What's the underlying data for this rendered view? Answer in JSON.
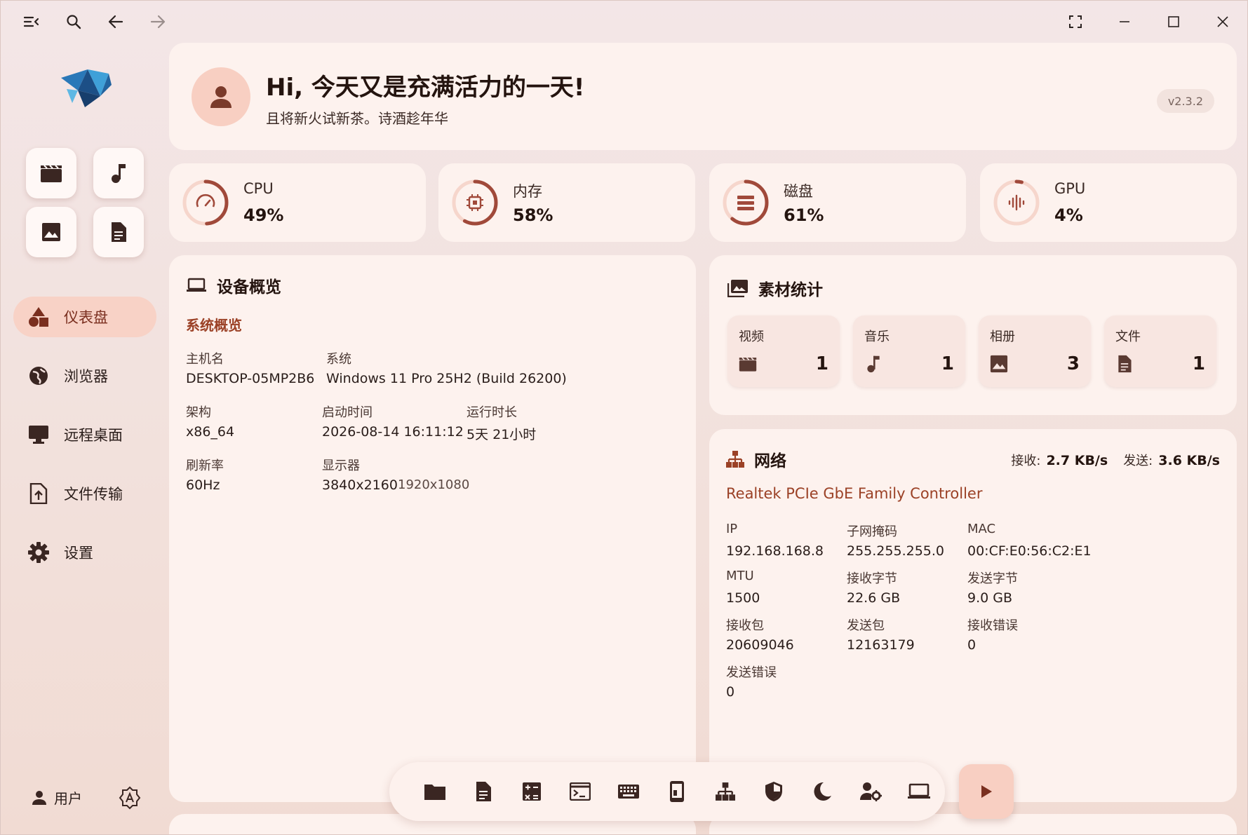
{
  "titlebar": {
    "left_icons": [
      "menu-collapse-icon",
      "search-icon",
      "back-arrow-icon",
      "forward-arrow-icon"
    ],
    "right_icons": [
      "fullscreen-icon",
      "minimize-icon",
      "maximize-icon",
      "close-icon"
    ]
  },
  "sidebar": {
    "quick_buttons": [
      "video-icon",
      "music-icon",
      "image-icon",
      "document-icon"
    ],
    "nav": [
      {
        "label": "仪表盘",
        "icon": "dashboard-shapes-icon",
        "active": true
      },
      {
        "label": "浏览器",
        "icon": "globe-icon",
        "active": false
      },
      {
        "label": "远程桌面",
        "icon": "monitor-icon",
        "active": false
      },
      {
        "label": "文件传输",
        "icon": "file-upload-icon",
        "active": false
      },
      {
        "label": "设置",
        "icon": "gear-icon",
        "active": false
      }
    ],
    "user_label": "用户"
  },
  "header": {
    "greeting": "Hi, 今天又是充满活力的一天!",
    "subtitle": "且将新火试新茶。诗酒趁年华",
    "version": "v2.3.2"
  },
  "stats": [
    {
      "label": "CPU",
      "value": "49%",
      "percent": 49,
      "icon": "speedometer-icon"
    },
    {
      "label": "内存",
      "value": "58%",
      "percent": 58,
      "icon": "chip-icon"
    },
    {
      "label": "磁盘",
      "value": "61%",
      "percent": 61,
      "icon": "disk-list-icon"
    },
    {
      "label": "GPU",
      "value": "4%",
      "percent": 4,
      "icon": "waveform-icon"
    }
  ],
  "device": {
    "title": "设备概览",
    "section": "系统概览",
    "hostname_label": "主机名",
    "hostname": "DESKTOP-05MP2B6",
    "os_label": "系统",
    "os": "Windows 11 Pro 25H2 (Build 26200)",
    "arch_label": "架构",
    "arch": "x86_64",
    "boot_label": "启动时间",
    "boot": "2026-08-14 16:11:12",
    "uptime_label": "运行时长",
    "uptime": "5天 21小时",
    "refresh_label": "刷新率",
    "refresh": "60Hz",
    "display_label": "显示器",
    "display_primary": "3840x2160",
    "display_secondary": "1920x1080"
  },
  "materials": {
    "title": "素材统计",
    "items": [
      {
        "label": "视频",
        "count": "1",
        "icon": "video-icon"
      },
      {
        "label": "音乐",
        "count": "1",
        "icon": "music-icon"
      },
      {
        "label": "相册",
        "count": "3",
        "icon": "image-icon"
      },
      {
        "label": "文件",
        "count": "1",
        "icon": "document-icon"
      }
    ]
  },
  "network": {
    "title": "网络",
    "recv_label": "接收:",
    "recv_rate": "2.7 KB/s",
    "send_label": "发送:",
    "send_rate": "3.6 KB/s",
    "adapter": "Realtek PCIe GbE Family Controller",
    "fields": [
      {
        "label": "IP",
        "value": "192.168.168.8"
      },
      {
        "label": "子网掩码",
        "value": "255.255.255.0"
      },
      {
        "label": "MAC",
        "value": "00:CF:E0:56:C2:E1"
      },
      {
        "label": "MTU",
        "value": "1500"
      },
      {
        "label": "接收字节",
        "value": "22.6 GB"
      },
      {
        "label": "发送字节",
        "value": "9.0 GB"
      },
      {
        "label": "接收包",
        "value": "20609046"
      },
      {
        "label": "发送包",
        "value": "12163179"
      },
      {
        "label": "接收错误",
        "value": "0"
      },
      {
        "label": "发送错误",
        "value": "0"
      }
    ]
  },
  "dock": {
    "icons": [
      "folder-icon",
      "document-icon",
      "calculator-icon",
      "terminal-icon",
      "keyboard-icon",
      "phone-icon",
      "network-tree-icon",
      "shield-icon",
      "moon-icon",
      "user-settings-icon",
      "laptop-icon"
    ],
    "play_icon": "play-icon"
  },
  "colors": {
    "accent": "#9b4126",
    "ring": "#a0493a",
    "ring_track": "#f6d6cc",
    "active_nav": "#f8d2c6"
  }
}
